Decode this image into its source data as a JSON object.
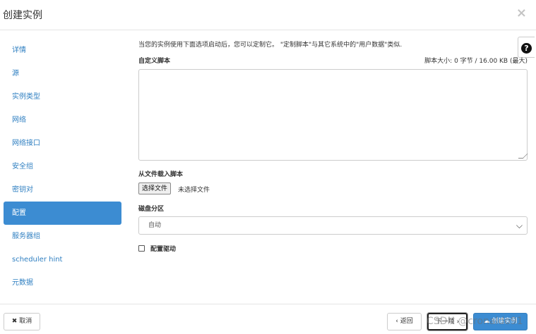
{
  "window": {
    "title": "创建实例",
    "close_label": "×"
  },
  "sidebar": {
    "items": [
      {
        "label": "详情"
      },
      {
        "label": "源"
      },
      {
        "label": "实例类型"
      },
      {
        "label": "网络"
      },
      {
        "label": "网络接口"
      },
      {
        "label": "安全组"
      },
      {
        "label": "密钥对"
      },
      {
        "label": "配置",
        "active": true
      },
      {
        "label": "服务器组"
      },
      {
        "label": "scheduler hint"
      },
      {
        "label": "元数据"
      }
    ]
  },
  "help": {
    "icon": "question-circle-icon",
    "label": "?"
  },
  "main": {
    "description": "当您的实例使用下面选项启动后，您可以定制它。 \"定制脚本\"与其它系统中的\"用户数据\"类似.",
    "custom_script_label": "自定义脚本",
    "script_size": "脚本大小: 0 字节 / 16.00 KB (最大)",
    "script_value": "",
    "load_from_file_label": "从文件载入脚本",
    "choose_file_button": "选择文件",
    "no_file_selected": "未选择文件",
    "disk_partition_label": "磁盘分区",
    "disk_partition_value": "自动",
    "config_drive_label": "配置驱动",
    "config_drive_checked": false
  },
  "footer": {
    "cancel_label": "✖ 取消",
    "back_label": "‹ 返回",
    "next_label": "下一项 ›",
    "create_label": "☁ 创建实例"
  },
  "watermark": "CSDN @cronaldo91",
  "colors": {
    "accent": "#3c8cd2",
    "link": "#2f7fc1"
  }
}
